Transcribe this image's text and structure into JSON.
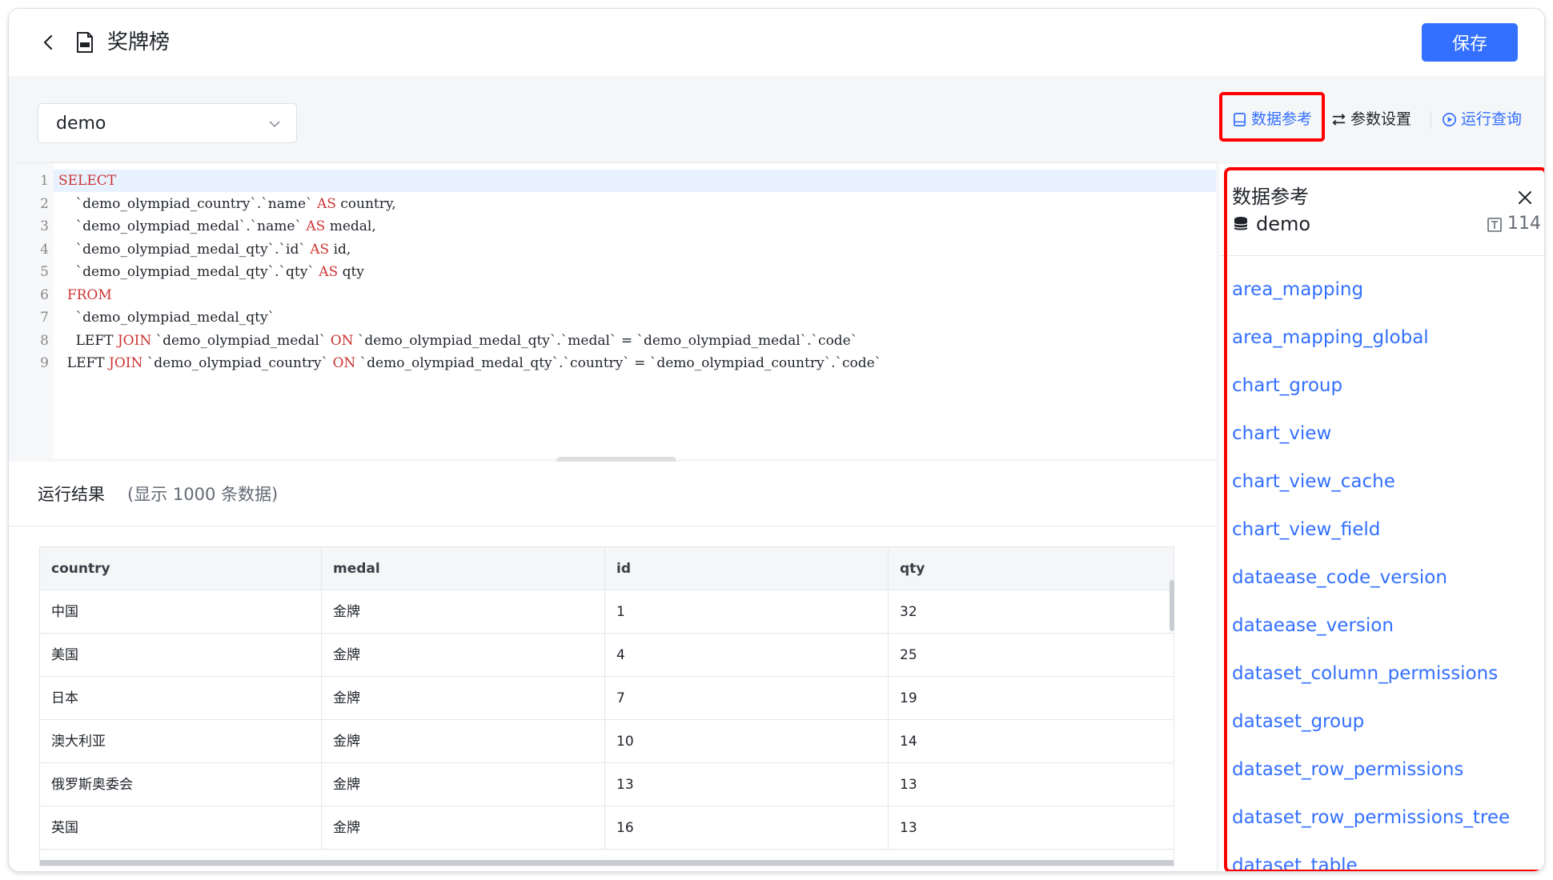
{
  "header": {
    "title": "奖牌榜",
    "save_label": "保存"
  },
  "datasource": {
    "selected": "demo"
  },
  "toolbar": {
    "data_reference": "数据参考",
    "param_settings": "参数设置",
    "run_query": "运行查询"
  },
  "editor": {
    "line_numbers": [
      "1",
      "2",
      "3",
      "4",
      "5",
      "6",
      "7",
      "8",
      "9"
    ]
  },
  "results": {
    "title": "运行结果",
    "subtitle": "(显示 1000 条数据)",
    "columns": [
      "country",
      "medal",
      "id",
      "qty"
    ],
    "rows": [
      [
        "中国",
        "金牌",
        "1",
        "32"
      ],
      [
        "美国",
        "金牌",
        "4",
        "25"
      ],
      [
        "日本",
        "金牌",
        "7",
        "19"
      ],
      [
        "澳大利亚",
        "金牌",
        "10",
        "14"
      ],
      [
        "俄罗斯奥委会",
        "金牌",
        "13",
        "13"
      ],
      [
        "英国",
        "金牌",
        "16",
        "13"
      ]
    ]
  },
  "panel": {
    "title": "数据参考",
    "database": "demo",
    "table_count": "114",
    "tables": [
      "area_mapping",
      "area_mapping_global",
      "chart_group",
      "chart_view",
      "chart_view_cache",
      "chart_view_field",
      "dataease_code_version",
      "dataease_version",
      "dataset_column_permissions",
      "dataset_group",
      "dataset_row_permissions",
      "dataset_row_permissions_tree",
      "dataset_table"
    ]
  },
  "colors": {
    "accent": "#3370ff",
    "highlight": "#ff0000",
    "keyword": "#cc3333"
  }
}
